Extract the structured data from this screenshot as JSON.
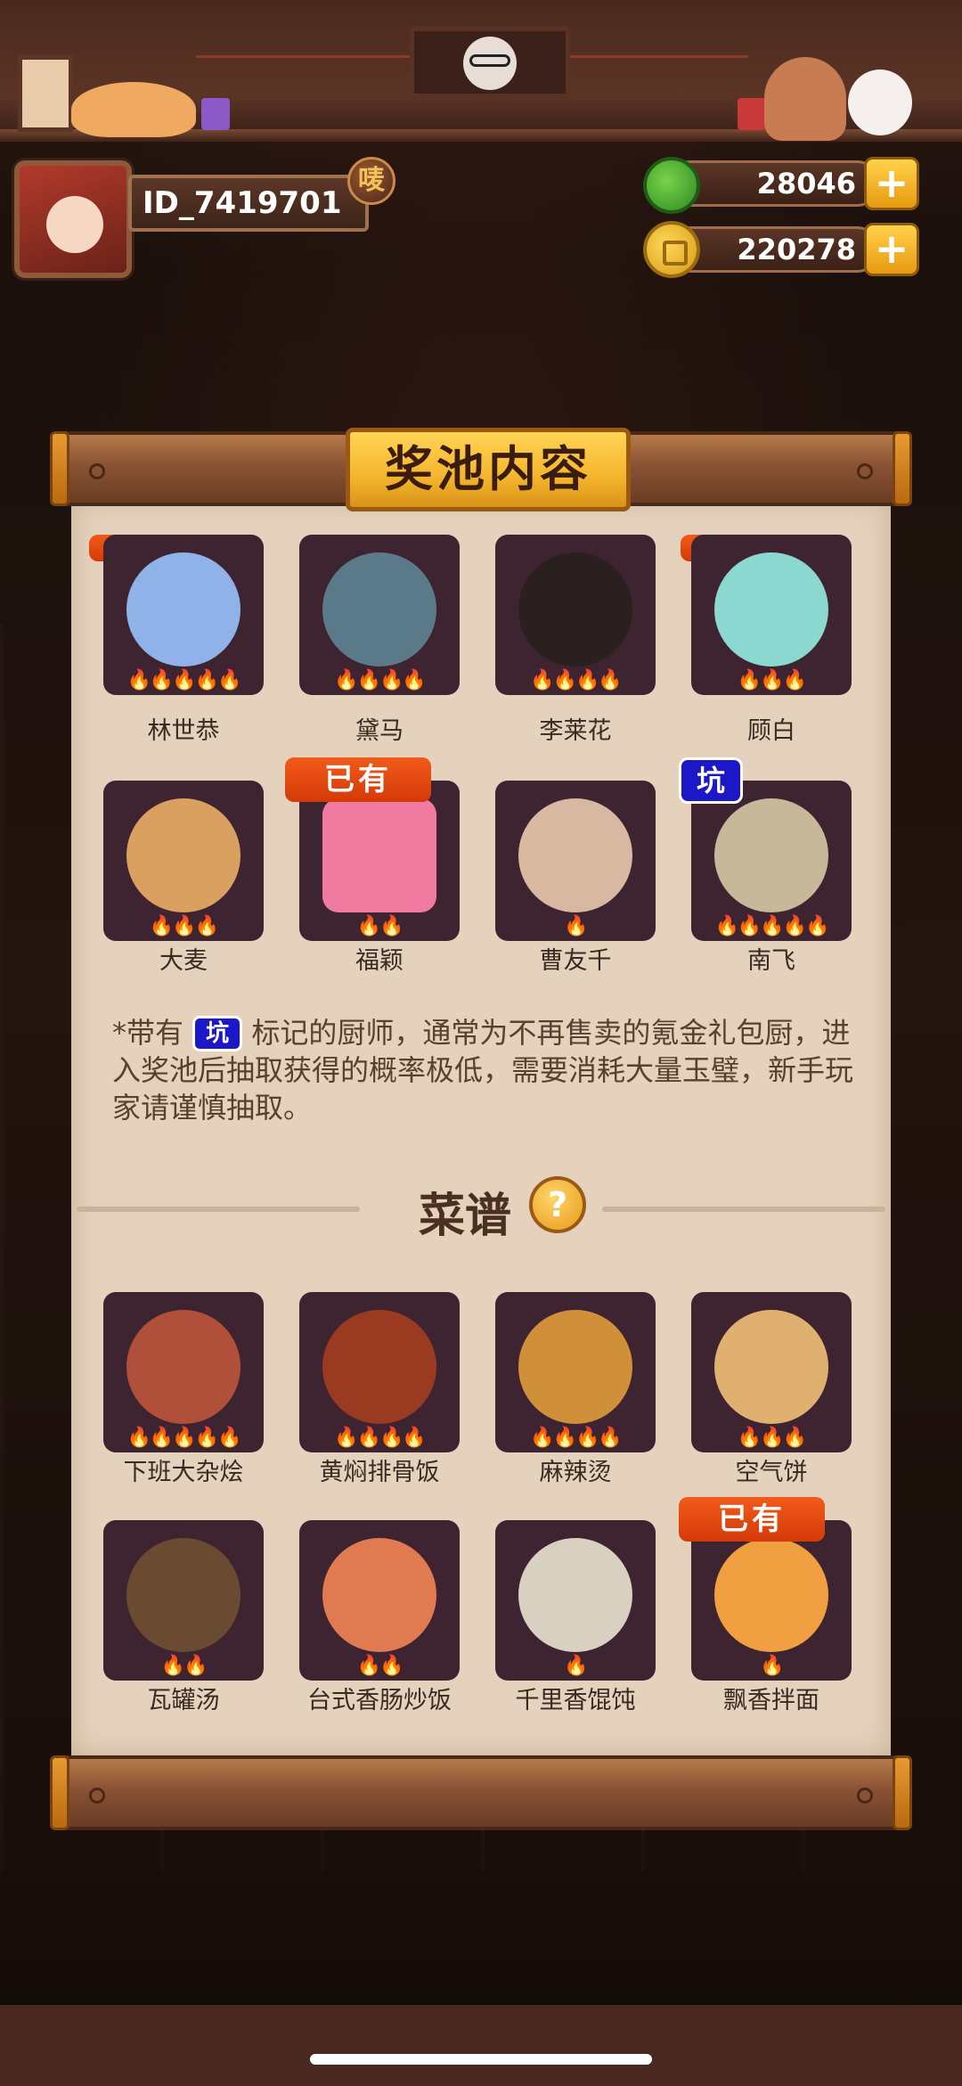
{
  "player": {
    "id": "ID_7419701",
    "badge": "唛"
  },
  "currency": {
    "jade": "28046",
    "coins": "220278",
    "plus": "+"
  },
  "panel": {
    "title": "奖池内容",
    "owned_tag": "已有",
    "pit_tag": "坑",
    "chefs": [
      {
        "name": "林世恭",
        "stars": "🔥🔥🔥🔥🔥",
        "color": "#8fb2e8"
      },
      {
        "name": "黛马",
        "stars": "🔥🔥🔥🔥",
        "color": "#5a7a8a"
      },
      {
        "name": "李莱花",
        "stars": "🔥🔥🔥🔥",
        "color": "#2a2020"
      },
      {
        "name": "顾白",
        "stars": "🔥🔥🔥",
        "color": "#8ad8d0"
      },
      {
        "name": "大麦",
        "stars": "🔥🔥🔥",
        "color": "#d9a060"
      },
      {
        "name": "福颖",
        "stars": "🔥🔥",
        "color": "#f07aa0"
      },
      {
        "name": "曹友千",
        "stars": "🔥",
        "color": "#d8b8a0"
      },
      {
        "name": "南飞",
        "stars": "🔥🔥🔥🔥🔥",
        "color": "#c8b89a"
      }
    ],
    "note_prefix": "*带有",
    "note_suffix": "标记的厨师，通常为不再售卖的氪金礼包厨，进入奖池后抽取获得的概率极低，需要消耗大量玉璧，新手玩家请谨慎抽取。",
    "recipes_title": "菜谱",
    "help": "?",
    "recipes": [
      {
        "name": "下班大杂烩",
        "stars": "🔥🔥🔥🔥🔥",
        "color": "#b0503a"
      },
      {
        "name": "黄焖排骨饭",
        "stars": "🔥🔥🔥🔥",
        "color": "#9a3a20"
      },
      {
        "name": "麻辣烫",
        "stars": "🔥🔥🔥🔥",
        "color": "#d0903a"
      },
      {
        "name": "空气饼",
        "stars": "🔥🔥🔥",
        "color": "#e0b070"
      },
      {
        "name": "瓦罐汤",
        "stars": "🔥🔥",
        "color": "#6a4a30"
      },
      {
        "name": "台式香肠炒饭",
        "stars": "🔥🔥",
        "color": "#e07a50"
      },
      {
        "name": "千里香馄饨",
        "stars": "🔥",
        "color": "#d8d0c0"
      },
      {
        "name": "飘香拌面",
        "stars": "🔥",
        "color": "#f0a040"
      }
    ]
  }
}
